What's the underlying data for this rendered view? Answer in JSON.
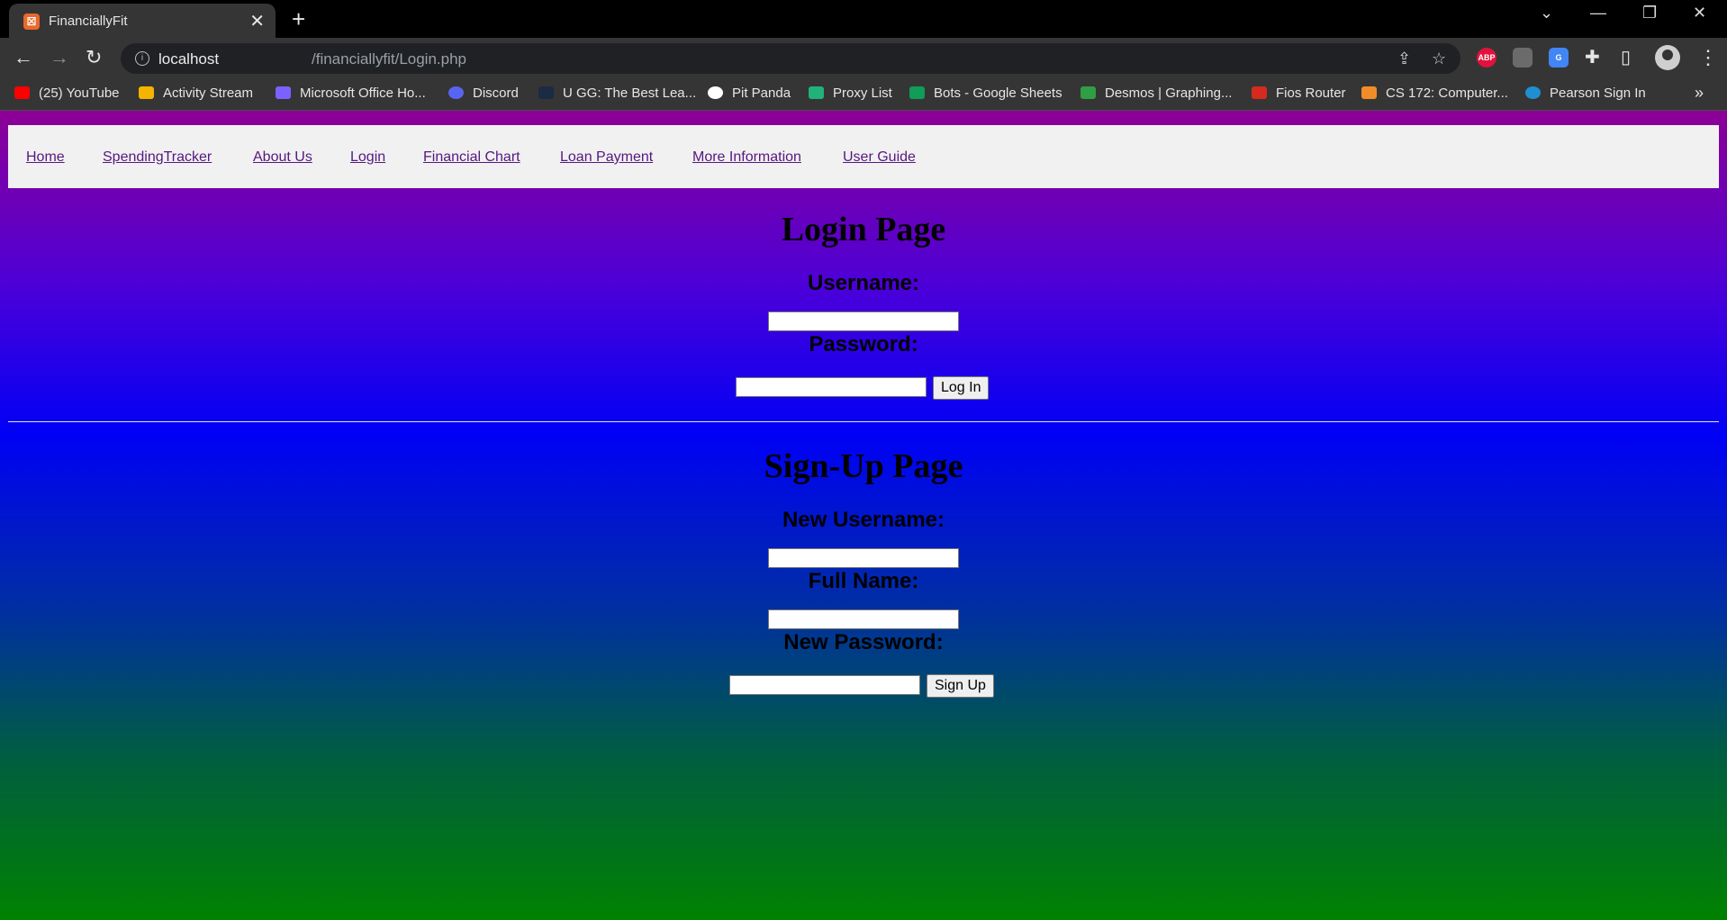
{
  "browser": {
    "tab_title": "FinanciallyFit",
    "url_host": "localhost",
    "url_path": "/financiallyfit/Login.php",
    "bookmarks": [
      {
        "label": "(25) YouTube",
        "color": "#ff0000"
      },
      {
        "label": "Activity Stream",
        "color": "#f4b400"
      },
      {
        "label": "Microsoft Office Ho...",
        "color": "#7b61ff"
      },
      {
        "label": "Discord",
        "color": "#5865f2"
      },
      {
        "label": "U GG: The Best Lea...",
        "color": "#1c2a44"
      },
      {
        "label": "Pit Panda",
        "color": "#ffffff"
      },
      {
        "label": "Proxy List",
        "color": "#20b27a"
      },
      {
        "label": "Bots - Google Sheets",
        "color": "#0f9d58"
      },
      {
        "label": "Desmos | Graphing...",
        "color": "#2f9e44"
      },
      {
        "label": "Fios Router",
        "color": "#d52b1e"
      },
      {
        "label": "CS 172: Computer...",
        "color": "#f28c28"
      },
      {
        "label": "Pearson Sign In",
        "color": "#1f8fd1"
      }
    ],
    "extensions": [
      "ABP"
    ]
  },
  "nav": {
    "links": [
      "Home",
      "SpendingTracker",
      "About Us",
      "Login",
      "Financial Chart",
      "Loan Payment",
      "More Information",
      "User Guide"
    ]
  },
  "login": {
    "title": "Login Page",
    "username_label": "Username:",
    "password_label": "Password:",
    "username_value": "",
    "password_value": "",
    "button": "Log In"
  },
  "signup": {
    "title": "Sign-Up Page",
    "new_username_label": "New Username:",
    "full_name_label": "Full Name:",
    "new_password_label": "New Password:",
    "new_username_value": "",
    "full_name_value": "",
    "new_password_value": "",
    "button": "Sign Up"
  }
}
